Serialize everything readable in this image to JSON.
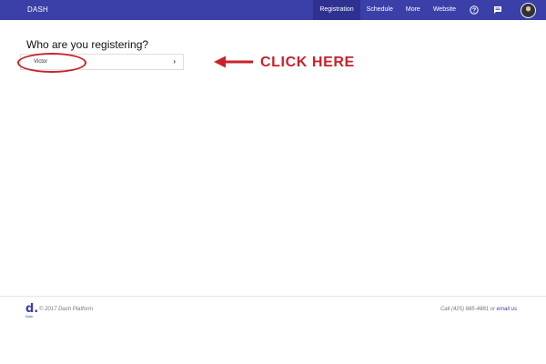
{
  "header": {
    "brand": "DASH",
    "nav": [
      "Registration",
      "Schedule",
      "More",
      "Website"
    ],
    "active_nav": "Registration",
    "icons": [
      "help-icon",
      "chat-icon"
    ],
    "avatar": "user-avatar"
  },
  "main": {
    "question": "Who are you registering?",
    "people": [
      {
        "name": "Victor",
        "chevron": "chevron-right-icon"
      }
    ]
  },
  "annotation": {
    "text": "CLICK HERE",
    "color": "#c8232c"
  },
  "footer": {
    "logo_letter": "d.",
    "logo_sub": "Dash",
    "copyright": "© 2017 Dash Platform",
    "contact_prefix": "Call (425) 885-4881 or ",
    "contact_link": "email us"
  },
  "colors": {
    "brand": "#3b3fa8",
    "brand_active": "#2e3190",
    "annotation": "#c8232c"
  }
}
